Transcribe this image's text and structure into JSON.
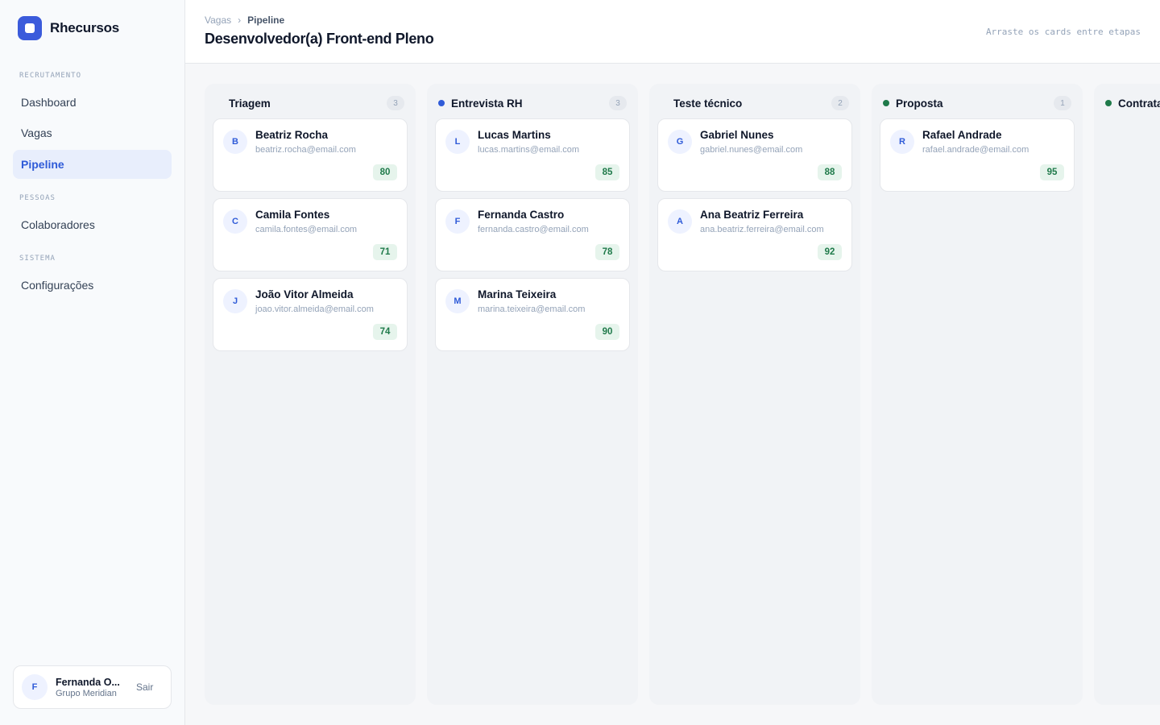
{
  "app": {
    "name": "Rhecursos"
  },
  "sidebar": {
    "sections": [
      {
        "label": "RECRUTAMENTO",
        "items": [
          {
            "label": "Dashboard",
            "active": false
          },
          {
            "label": "Vagas",
            "active": false
          },
          {
            "label": "Pipeline",
            "active": true
          }
        ]
      },
      {
        "label": "PESSOAS",
        "items": [
          {
            "label": "Colaboradores",
            "active": false
          }
        ]
      },
      {
        "label": "SISTEMA",
        "items": [
          {
            "label": "Configurações",
            "active": false
          }
        ]
      }
    ],
    "user": {
      "initial": "F",
      "name": "Fernanda O...",
      "org": "Grupo Meridian",
      "logout_label": "Sair"
    }
  },
  "header": {
    "breadcrumb": {
      "parent": "Vagas",
      "separator": "›",
      "current": "Pipeline"
    },
    "title": "Desenvolvedor(a) Front-end Pleno",
    "hint": "Arraste os cards entre etapas"
  },
  "colors": {
    "accent": "#2f5bd8",
    "stage_blue": "#2f5bd8",
    "stage_green": "#1f7a4a",
    "score_bg": "#e6f4ec",
    "score_text": "#1f7a4a"
  },
  "columns": [
    {
      "title": "Triagem",
      "count": "3",
      "dot_color": "",
      "cards": [
        {
          "initial": "B",
          "name": "Beatriz Rocha",
          "email": "beatriz.rocha@email.com",
          "score": "80"
        },
        {
          "initial": "C",
          "name": "Camila Fontes",
          "email": "camila.fontes@email.com",
          "score": "71"
        },
        {
          "initial": "J",
          "name": "João Vitor Almeida",
          "email": "joao.vitor.almeida@email.com",
          "score": "74"
        }
      ]
    },
    {
      "title": "Entrevista RH",
      "count": "3",
      "dot_color": "#2f5bd8",
      "cards": [
        {
          "initial": "L",
          "name": "Lucas Martins",
          "email": "lucas.martins@email.com",
          "score": "85"
        },
        {
          "initial": "F",
          "name": "Fernanda Castro",
          "email": "fernanda.castro@email.com",
          "score": "78"
        },
        {
          "initial": "M",
          "name": "Marina Teixeira",
          "email": "marina.teixeira@email.com",
          "score": "90"
        }
      ]
    },
    {
      "title": "Teste técnico",
      "count": "2",
      "dot_color": "",
      "cards": [
        {
          "initial": "G",
          "name": "Gabriel Nunes",
          "email": "gabriel.nunes@email.com",
          "score": "88"
        },
        {
          "initial": "A",
          "name": "Ana Beatriz Ferreira",
          "email": "ana.beatriz.ferreira@email.com",
          "score": "92"
        }
      ]
    },
    {
      "title": "Proposta",
      "count": "1",
      "dot_color": "#1f7a4a",
      "cards": [
        {
          "initial": "R",
          "name": "Rafael Andrade",
          "email": "rafael.andrade@email.com",
          "score": "95"
        }
      ]
    },
    {
      "title": "Contrata",
      "count": "",
      "dot_color": "#1f7a4a",
      "cards": []
    }
  ]
}
